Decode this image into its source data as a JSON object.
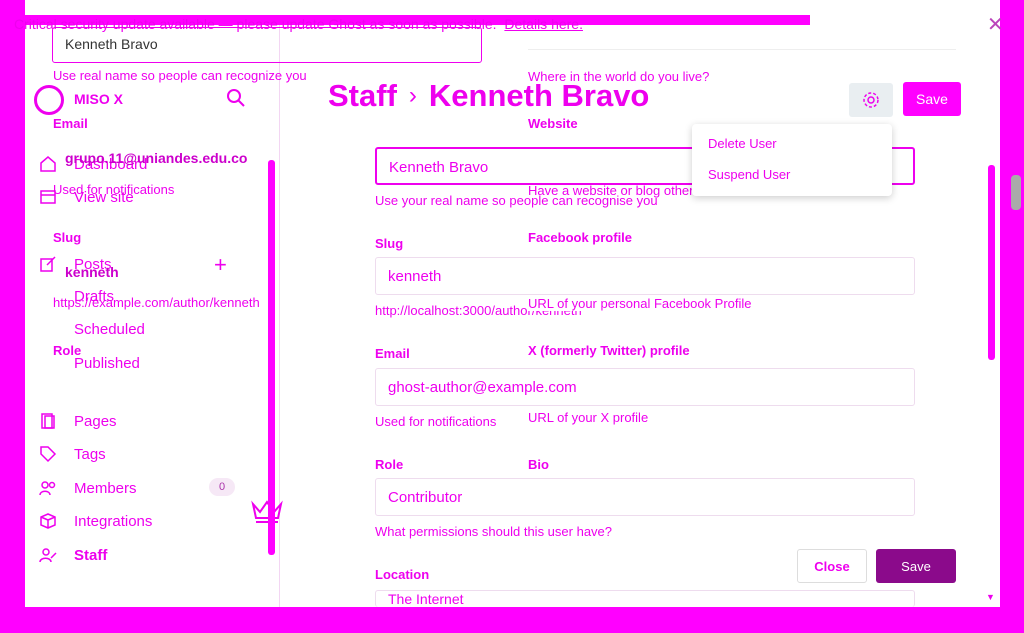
{
  "banner": {
    "text": "Critical security update available — please update Ghost as soon as possible.",
    "link": "Details here."
  },
  "sidebar": {
    "brand": "MISO X",
    "nav": {
      "dashboard": "Dashboard",
      "view_site": "View site",
      "posts": "Posts",
      "drafts": "Drafts",
      "scheduled": "Scheduled",
      "published": "Published",
      "pages": "Pages",
      "tags": "Tags",
      "members": "Members",
      "members_count": "0",
      "integrations": "Integrations",
      "staff": "Staff"
    }
  },
  "overlay": {
    "name_value": "Kenneth Bravo",
    "name_hint": "Use real name so people can recognize you",
    "email_label": "Email",
    "email_value": "grupo.11@uniandes.edu.co",
    "email_hint": "Used for notifications",
    "slug_label": "Slug",
    "slug_value": "kenneth",
    "slug_url": "https://example.com/author/kenneth",
    "role_label": "Role"
  },
  "header": {
    "breadcrumb_parent": "Staff",
    "breadcrumb_sep": "›",
    "title": "Kenneth Bravo",
    "save_label": "Save"
  },
  "menu": {
    "delete": "Delete User",
    "suspend": "Suspend User"
  },
  "form": {
    "name_value": "Kenneth Bravo",
    "name_hint": "Use your real name so people can recognise you",
    "slug_label": "Slug",
    "slug_value": "kenneth",
    "slug_hint": "http://localhost:3000/author/kenneth",
    "email_label": "Email",
    "email_value": "ghost-author@example.com",
    "email_hint": "Used for notifications",
    "role_label": "Role",
    "role_value": "Contributor",
    "role_hint": "What permissions should this user have?",
    "location_label": "Location",
    "location_value": "The Internet"
  },
  "right": {
    "location_hint": "Where in the world do you live?",
    "website_label": "Website",
    "website_hint": "Have a website or blog other than this one? Link it!",
    "facebook_label": "Facebook profile",
    "facebook_hint": "URL of your personal Facebook Profile",
    "x_label": "X (formerly Twitter) profile",
    "x_hint": "URL of your X profile",
    "bio_label": "Bio"
  },
  "footer": {
    "close_label": "Close",
    "save_label": "Save"
  },
  "colors": {
    "accent": "#ff00ff",
    "dark_save": "#8b0a8b"
  }
}
